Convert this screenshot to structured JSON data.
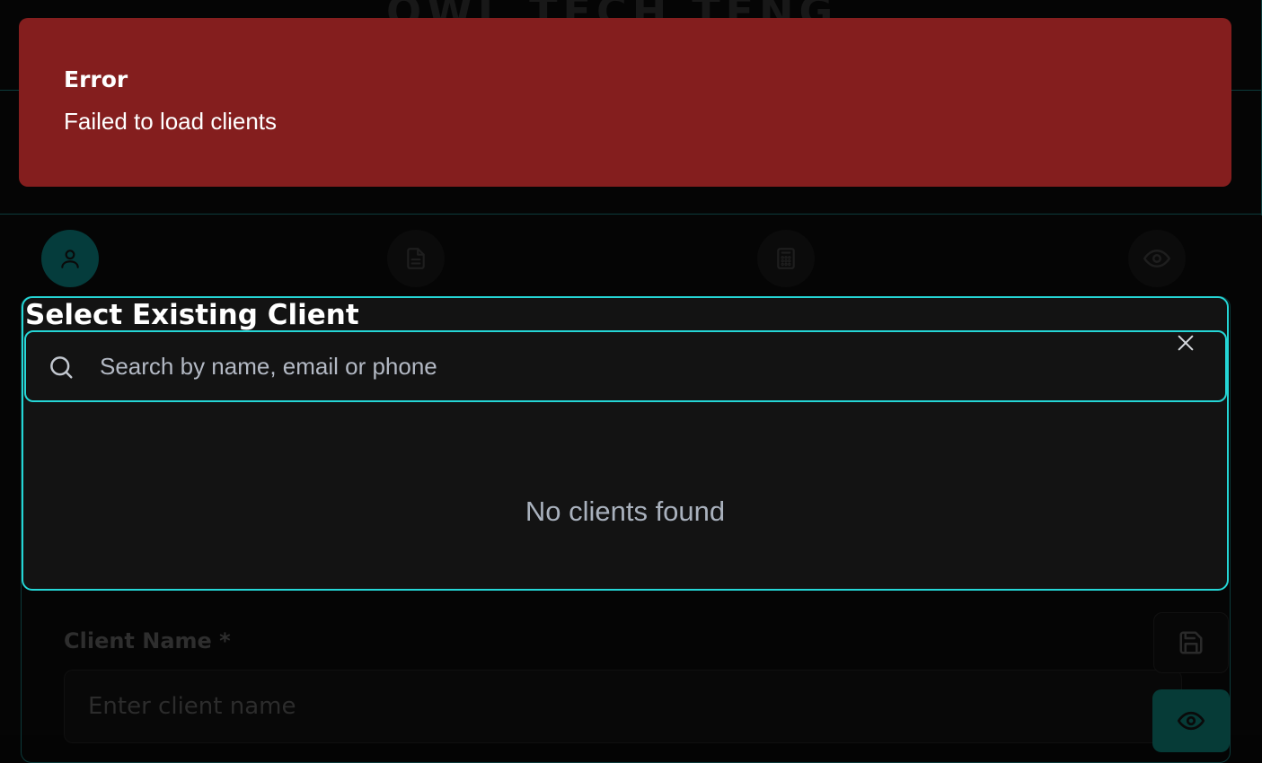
{
  "background": {
    "logo_text": "OWL TECH TENG",
    "form": {
      "client_name_label": "Client Name *",
      "client_name_placeholder": "Enter client name"
    },
    "steps": [
      {
        "icon": "user-icon"
      },
      {
        "icon": "document-icon"
      },
      {
        "icon": "calculator-icon"
      },
      {
        "icon": "eye-icon"
      }
    ],
    "side_buttons": [
      {
        "icon": "save-icon"
      },
      {
        "icon": "eye-icon"
      }
    ]
  },
  "toast": {
    "title": "Error",
    "message": "Failed to load clients",
    "color": "#841e1e"
  },
  "client_picker": {
    "title": "Select Existing Client",
    "search_placeholder": "Search by name, email or phone",
    "search_value": "",
    "empty_text": "No clients found",
    "accent_color": "#25d6d6",
    "close_icon": "close-icon",
    "search_icon": "search-icon"
  }
}
